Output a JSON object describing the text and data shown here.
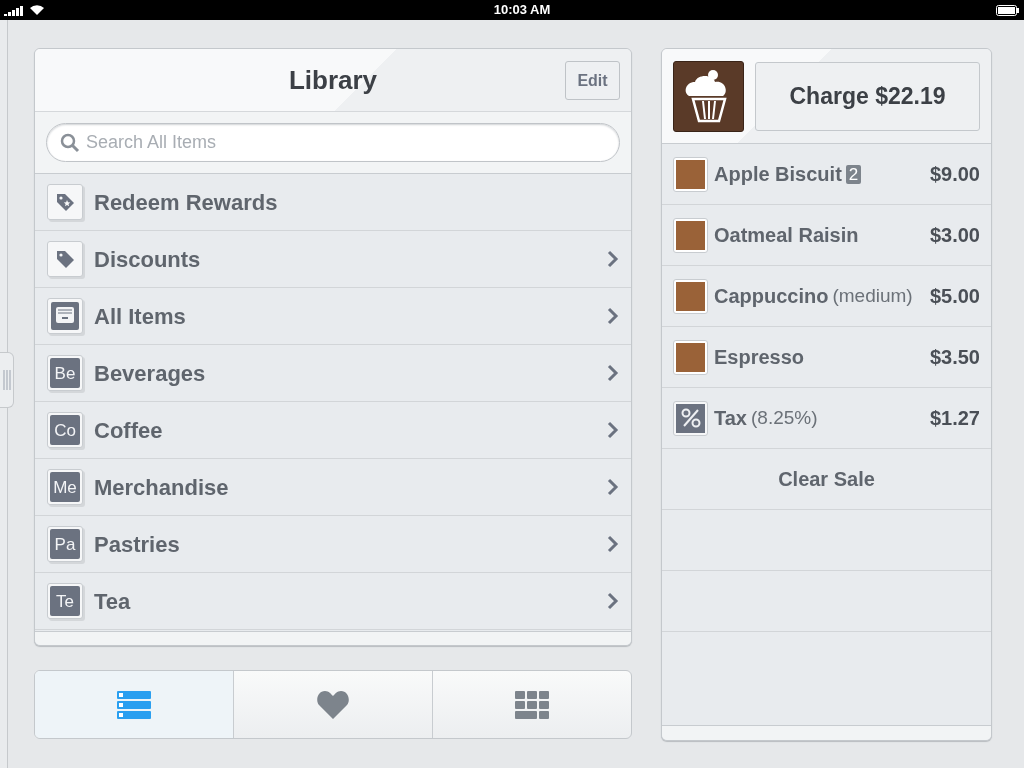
{
  "status_bar": {
    "time": "10:03 AM"
  },
  "library": {
    "title": "Library",
    "edit_button": "Edit",
    "search": {
      "placeholder": "Search All Items"
    },
    "items": [
      {
        "kind": "rewards",
        "label": "Redeem Rewards",
        "chevron": false
      },
      {
        "kind": "discounts",
        "label": "Discounts",
        "chevron": true
      },
      {
        "kind": "all",
        "label": "All Items",
        "chevron": true
      },
      {
        "kind": "category",
        "abbr": "Be",
        "label": "Beverages",
        "chevron": true
      },
      {
        "kind": "category",
        "abbr": "Co",
        "label": "Coffee",
        "chevron": true
      },
      {
        "kind": "category",
        "abbr": "Me",
        "label": "Merchandise",
        "chevron": true
      },
      {
        "kind": "category",
        "abbr": "Pa",
        "label": "Pastries",
        "chevron": true
      },
      {
        "kind": "category",
        "abbr": "Te",
        "label": "Tea",
        "chevron": true
      }
    ]
  },
  "view_tabs": [
    {
      "kind": "list",
      "selected": true
    },
    {
      "kind": "favorites",
      "selected": false
    },
    {
      "kind": "grid",
      "selected": false
    }
  ],
  "sale": {
    "charge_button": "Charge $22.19",
    "lines": [
      {
        "kind": "item",
        "name": "Apple Biscuit",
        "quantity": "2",
        "price": "$9.00"
      },
      {
        "kind": "item",
        "name": "Oatmeal Raisin",
        "price": "$3.00"
      },
      {
        "kind": "item",
        "name": "Cappuccino",
        "note": "(medium)",
        "price": "$5.00"
      },
      {
        "kind": "item",
        "name": "Espresso",
        "price": "$3.50"
      },
      {
        "kind": "tax",
        "name": "Tax",
        "note": "(8.25%)",
        "price": "$1.27"
      }
    ],
    "clear_button": "Clear Sale"
  }
}
